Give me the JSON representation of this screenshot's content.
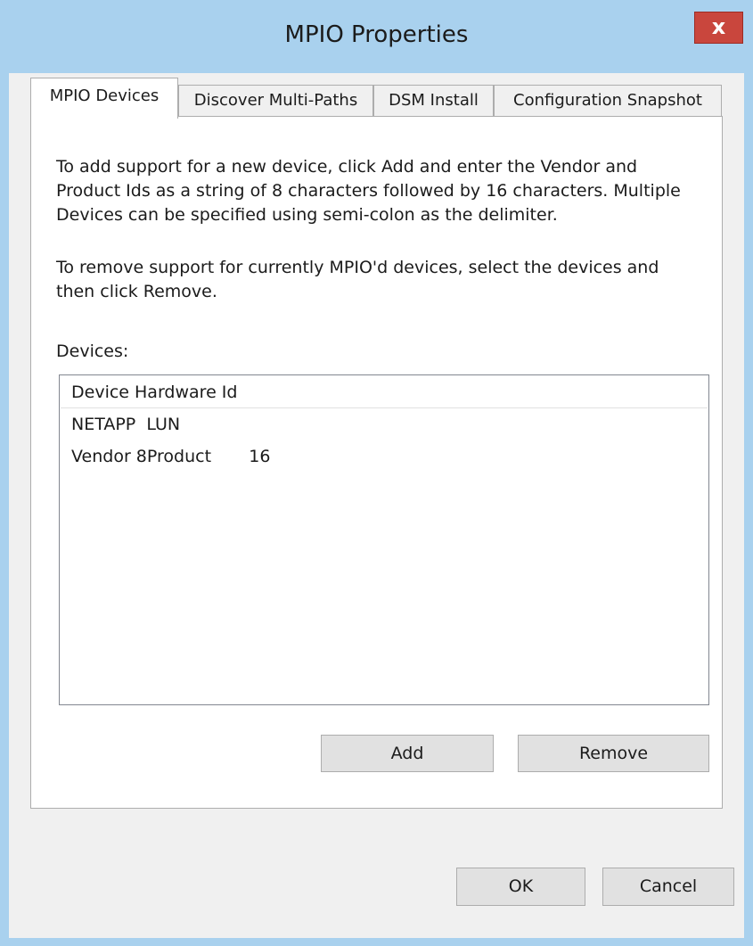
{
  "window": {
    "title": "MPIO Properties",
    "close_glyph": "x"
  },
  "tabs": [
    {
      "label": "MPIO Devices",
      "active": true
    },
    {
      "label": "Discover Multi-Paths",
      "active": false
    },
    {
      "label": "DSM Install",
      "active": false
    },
    {
      "label": "Configuration Snapshot",
      "active": false
    }
  ],
  "panel": {
    "intro_text": "To add support for a new device, click Add and enter the Vendor and Product Ids as a string of 8 characters followed by 16 characters. Multiple Devices can be specified using semi-colon as the delimiter.",
    "remove_text": "To remove support for currently MPIO'd devices, select the devices and then click Remove.",
    "devices_label": "Devices:",
    "list": {
      "header": "Device Hardware Id",
      "items": [
        "NETAPP  LUN",
        "Vendor 8Product       16"
      ]
    },
    "add_label": "Add",
    "remove_label": "Remove"
  },
  "footer": {
    "ok_label": "OK",
    "cancel_label": "Cancel"
  },
  "colors": {
    "frame": "#a9d1ee",
    "close_button": "#c9463d",
    "dialog_background": "#f0f0f0",
    "button_face": "#e1e1e1"
  }
}
